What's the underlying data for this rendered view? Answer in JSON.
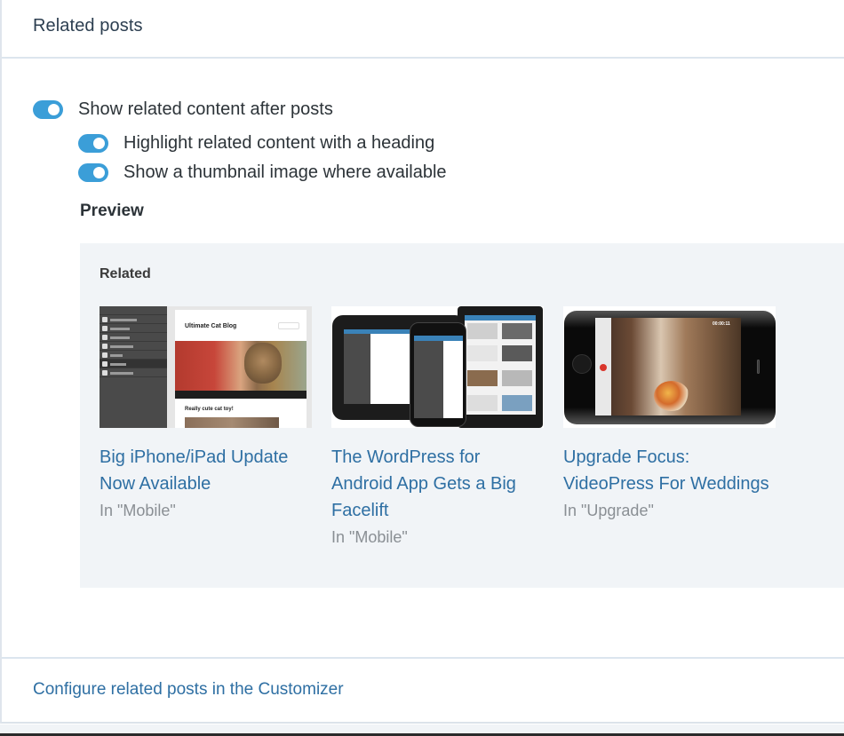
{
  "card": {
    "title": "Related posts"
  },
  "settings": {
    "main_toggle": {
      "label": "Show related content after posts",
      "enabled": true
    },
    "sub_toggles": [
      {
        "label": "Highlight related content with a heading",
        "enabled": true
      },
      {
        "label": "Show a thumbnail image where available",
        "enabled": true
      }
    ]
  },
  "preview": {
    "heading": "Preview",
    "related_heading": "Related",
    "posts": [
      {
        "title": "Big iPhone/iPad Update Now Available",
        "category": "In \"Mobile\"",
        "thumbnail": {
          "description": "wordpress-ipad-app-screenshot",
          "blog_title": "Ultimate Cat Blog",
          "post_heading": "Really cute cat toy!"
        }
      },
      {
        "title": "The WordPress for Android App Gets a Big Facelift",
        "category": "In \"Mobile\"",
        "thumbnail": {
          "description": "wordpress-android-devices"
        }
      },
      {
        "title": "Upgrade Focus: VideoPress For Weddings",
        "category": "In \"Upgrade\"",
        "thumbnail": {
          "description": "iphone-video-recording-wedding",
          "timer": "00:00:11"
        }
      }
    ]
  },
  "footer": {
    "link_label": "Configure related posts in the Customizer"
  },
  "colors": {
    "toggle_on": "#3b9ed8",
    "link": "#2e6fa3",
    "preview_bg": "#f1f4f7",
    "category_text": "#8a8f94"
  }
}
